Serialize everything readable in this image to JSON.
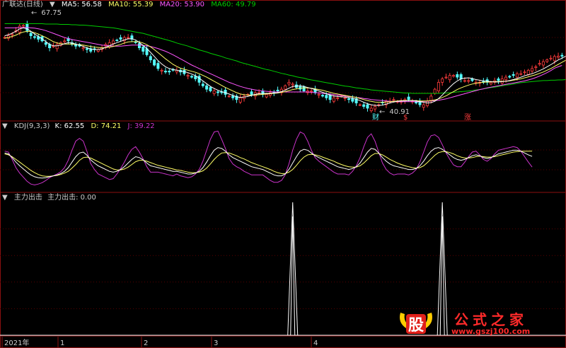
{
  "colors": {
    "background": "#000000",
    "border": "#8b1010",
    "grid": "#5a0000",
    "up_candle": "#ff3c3c",
    "down_candle": "#54ffff",
    "ma5": "#ffffff",
    "ma10": "#ffff66",
    "ma20": "#ff55ff",
    "ma60": "#00cc00",
    "kdj_k": "#ffffff",
    "kdj_d": "#ffff66",
    "kdj_j": "#cc33cc",
    "signal": "#ffffff"
  },
  "price_panel": {
    "title": "广联达(日线)",
    "ma5_label": "MA5: 56.58",
    "ma10_label": "MA10: 55.39",
    "ma20_label": "MA20: 53.90",
    "ma60_label": "MA60: 49.79",
    "high_marker": "67.75",
    "low_marker": "40.91",
    "flag_cai": "财",
    "flag_s": "$",
    "flag_zhang": "涨"
  },
  "kdj_panel": {
    "title": "KDJ(9,3,3)",
    "k_label": "K: 62.55",
    "d_label": "D: 74.21",
    "j_label": "J: 39.22"
  },
  "signal_panel": {
    "title": "主力出击",
    "value_label": "主力出击: 0.00"
  },
  "time_axis": {
    "labels": [
      "2021年",
      "1",
      "2",
      "3",
      "4"
    ]
  },
  "watermark": {
    "logo_char": "股",
    "title": "公式之家",
    "url": "www.gszj100.com"
  },
  "chart_data": [
    {
      "type": "line",
      "name": "price candlestick with moving averages",
      "x_range": [
        0,
        150
      ],
      "ylim": [
        38,
        70
      ],
      "close": [
        62,
        62.5,
        63,
        64,
        65.3,
        65.5,
        64,
        62.5,
        62,
        61.5,
        61,
        60,
        59,
        59.5,
        60,
        60.5,
        61,
        61,
        60,
        59.5,
        59.5,
        59,
        58.5,
        58,
        58.5,
        58.5,
        59,
        60,
        60.5,
        61,
        61.2,
        61.5,
        62,
        62,
        61.5,
        60.5,
        59,
        58,
        57,
        55.5,
        54,
        53,
        52.5,
        52,
        52,
        52.5,
        52.5,
        52,
        51.5,
        51,
        50.5,
        50,
        49,
        48,
        47,
        46.5,
        46.5,
        46,
        46,
        45.5,
        45,
        44.5,
        44,
        44.5,
        45,
        45.5,
        45.5,
        46,
        46,
        45.5,
        45.5,
        46,
        46,
        46.5,
        47,
        48,
        49,
        48.5,
        47.5,
        47,
        46.5,
        46.5,
        46.5,
        46,
        45.5,
        45,
        44.5,
        44,
        44.5,
        44.5,
        45,
        44.5,
        44,
        43.5,
        43,
        42.5,
        42,
        41.5,
        41.5,
        42,
        42.5,
        43,
        43.5,
        43.5,
        44,
        43.5,
        43.5,
        44,
        44,
        43.5,
        43,
        42.5,
        42.5,
        43.5,
        45,
        47,
        49,
        50,
        50.5,
        51,
        51,
        50.5,
        50,
        49.5,
        49.5,
        49.5,
        49,
        49,
        49,
        49,
        49,
        49.5,
        49.5,
        50,
        50.5,
        50.5,
        51,
        51.5,
        51.5,
        52,
        52.5,
        53,
        53.5,
        54.5,
        55,
        55.5,
        56,
        56.5,
        56.6,
        56.58
      ],
      "ma5": [
        62.5,
        62.8,
        63.2,
        63.8,
        64.5,
        64.8,
        64.5,
        63.8,
        63,
        62.3,
        61.6,
        60.8,
        60,
        59.6,
        59.6,
        59.8,
        60.2,
        60.5,
        60.4,
        60.1,
        59.8,
        59.4,
        59,
        58.7,
        58.5,
        58.5,
        58.7,
        59.1,
        59.6,
        60.1,
        60.5,
        60.9,
        61.3,
        61.6,
        61.6,
        61.3,
        60.5,
        59.7,
        58.8,
        57.7,
        56.5,
        55.3,
        54.3,
        53.5,
        53,
        52.7,
        52.5,
        52.3,
        52.1,
        51.8,
        51.4,
        50.9,
        50.2,
        49.4,
        48.6,
        47.8,
        47.2,
        46.7,
        46.3,
        46,
        45.6,
        45.2,
        44.8,
        44.6,
        44.7,
        44.9,
        45.2,
        45.5,
        45.7,
        45.8,
        45.8,
        45.8,
        45.9,
        46,
        46.3,
        46.7,
        47.3,
        47.8,
        47.9,
        48,
        47.8,
        47.5,
        47.2,
        46.9,
        46.5,
        46.1,
        45.7,
        45.3,
        45,
        44.9,
        44.8,
        44.7,
        44.6,
        44.4,
        44.1,
        43.7,
        43.2,
        42.8,
        42.5,
        42.3,
        42.3,
        42.4,
        42.7,
        43,
        43.3,
        43.5,
        43.6,
        43.6,
        43.7,
        43.7,
        43.6,
        43.4,
        43.2,
        43,
        43.1,
        43.5,
        44.3,
        45.3,
        46.5,
        47.6,
        48.6,
        49.4,
        50,
        50.2,
        50.3,
        50.1,
        49.8,
        49.6,
        49.4,
        49.3,
        49.2,
        49.1,
        49.1,
        49.2,
        49.3,
        49.5,
        49.8,
        50.1,
        50.5,
        50.9,
        51.2,
        51.5,
        51.9,
        52.4,
        52.9,
        53.5,
        54.1,
        54.8,
        55.5,
        56,
        56.58
      ],
      "ma10": [
        61.8,
        62,
        62.3,
        62.7,
        63.2,
        63.6,
        63.8,
        63.7,
        63.4,
        63,
        62.5,
        62,
        61.4,
        60.8,
        60.4,
        60.2,
        60.1,
        60.1,
        60.1,
        60,
        59.9,
        59.8,
        59.6,
        59.4,
        59.2,
        59.1,
        59,
        59.1,
        59.2,
        59.4,
        59.7,
        60,
        60.4,
        60.7,
        60.8,
        60.8,
        60.7,
        60.4,
        59.9,
        59.3,
        58.5,
        57.6,
        56.7,
        55.8,
        55,
        54.2,
        53.6,
        53.1,
        52.8,
        52.5,
        52.2,
        51.9,
        51.5,
        51,
        50.5,
        49.9,
        49.3,
        48.7,
        48.1,
        47.5,
        47,
        46.5,
        46,
        45.6,
        45.4,
        45.3,
        45.3,
        45.3,
        45.4,
        45.5,
        45.6,
        45.7,
        45.8,
        45.9,
        46.1,
        46.3,
        46.6,
        46.9,
        47.1,
        47.3,
        47.4,
        47.4,
        47.3,
        47.1,
        46.9,
        46.7,
        46.4,
        46.1,
        45.8,
        45.6,
        45.4,
        45.2,
        45,
        44.8,
        44.6,
        44.3,
        44,
        43.7,
        43.5,
        43.3,
        43.2,
        43.2,
        43.3,
        43.4,
        43.5,
        43.6,
        43.7,
        43.7,
        43.7,
        43.7,
        43.7,
        43.6,
        43.6,
        43.6,
        43.7,
        43.9,
        44.2,
        44.6,
        45.1,
        45.7,
        46.3,
        46.9,
        47.4,
        47.8,
        48.2,
        48.5,
        48.7,
        48.9,
        49,
        49.1,
        49.1,
        49.2,
        49.2,
        49.3,
        49.3,
        49.4,
        49.6,
        49.8,
        50,
        50.3,
        50.6,
        50.9,
        51.2,
        51.6,
        52,
        52.5,
        53,
        53.6,
        54.2,
        54.8,
        55.39
      ],
      "ma20": [
        64.8,
        64.8,
        64.8,
        64.8,
        64.9,
        64.9,
        64.9,
        64.8,
        64.7,
        64.5,
        64.3,
        64,
        63.6,
        63.2,
        62.8,
        62.4,
        62,
        61.7,
        61.4,
        61.2,
        61,
        60.8,
        60.6,
        60.4,
        60.2,
        60,
        59.8,
        59.7,
        59.6,
        59.5,
        59.5,
        59.5,
        59.6,
        59.7,
        59.8,
        59.8,
        59.8,
        59.7,
        59.6,
        59.4,
        59.1,
        58.8,
        58.4,
        58,
        57.5,
        57,
        56.4,
        55.8,
        55.2,
        54.6,
        54,
        53.5,
        53,
        52.5,
        52,
        51.5,
        51,
        50.5,
        50,
        49.5,
        49,
        48.6,
        48.2,
        47.8,
        47.5,
        47.2,
        47,
        46.8,
        46.6,
        46.5,
        46.4,
        46.3,
        46.2,
        46.2,
        46.2,
        46.2,
        46.2,
        46.2,
        46.2,
        46.2,
        46.2,
        46.2,
        46.1,
        46,
        45.9,
        45.8,
        45.7,
        45.6,
        45.4,
        45.3,
        45.2,
        45,
        44.9,
        44.8,
        44.6,
        44.5,
        44.3,
        44.2,
        44,
        43.9,
        43.8,
        43.7,
        43.6,
        43.5,
        43.5,
        43.4,
        43.4,
        43.4,
        43.4,
        43.4,
        43.4,
        43.4,
        43.5,
        43.5,
        43.6,
        43.7,
        43.8,
        44,
        44.2,
        44.5,
        44.8,
        45.1,
        45.4,
        45.7,
        46,
        46.3,
        46.6,
        46.9,
        47.1,
        47.4,
        47.6,
        47.8,
        48,
        48.2,
        48.4,
        48.6,
        48.8,
        49,
        49.2,
        49.4,
        49.7,
        50,
        50.4,
        50.8,
        51.3,
        51.8,
        52.4,
        53.1,
        53.5,
        53.9
      ],
      "ma60": [
        66,
        66,
        66,
        66,
        66,
        66,
        66,
        66,
        66,
        66,
        66,
        65.9,
        65.9,
        65.9,
        65.9,
        65.8,
        65.8,
        65.8,
        65.7,
        65.7,
        65.6,
        65.6,
        65.5,
        65.4,
        65.3,
        65.2,
        65.1,
        65,
        64.9,
        64.8,
        64.6,
        64.4,
        64.2,
        64,
        63.8,
        63.6,
        63.4,
        63.2,
        62.9,
        62.6,
        62.3,
        62,
        61.7,
        61.4,
        61.1,
        60.8,
        60.4,
        60.1,
        59.8,
        59.5,
        59.1,
        58.8,
        58.4,
        58.1,
        57.8,
        57.4,
        57.1,
        56.8,
        56.5,
        56.1,
        55.8,
        55.5,
        55.2,
        54.8,
        54.5,
        54.2,
        53.9,
        53.6,
        53.3,
        53,
        52.7,
        52.5,
        52.2,
        51.9,
        51.6,
        51.4,
        51.1,
        50.9,
        50.6,
        50.4,
        50.2,
        49.9,
        49.7,
        49.5,
        49.3,
        49.1,
        48.9,
        48.7,
        48.5,
        48.3,
        48.1,
        47.9,
        47.8,
        47.6,
        47.4,
        47.3,
        47.1,
        47,
        46.8,
        46.7,
        46.6,
        46.5,
        46.4,
        46.3,
        46.2,
        46.1,
        46,
        45.9,
        45.9,
        45.8,
        45.8,
        45.8,
        45.8,
        45.8,
        45.8,
        45.8,
        45.8,
        45.9,
        45.9,
        46,
        46.1,
        46.2,
        46.3,
        46.4,
        46.5,
        46.6,
        46.8,
        46.9,
        47.1,
        47.3,
        47.5,
        47.6,
        47.8,
        48,
        48.2,
        48.3,
        48.5,
        48.7,
        48.9,
        49,
        49.1,
        49.2,
        49.3,
        49.4,
        49.5,
        49.5,
        49.6,
        49.6,
        49.7,
        49.7,
        49.79
      ]
    },
    {
      "type": "line",
      "name": "KDJ(9,3,3)",
      "ylim": [
        0,
        100
      ],
      "k": [
        70,
        68,
        60,
        50,
        42,
        35,
        28,
        22,
        18,
        16,
        15,
        16,
        18,
        20,
        22,
        25,
        30,
        38,
        50,
        62,
        70,
        72,
        65,
        55,
        48,
        42,
        38,
        34,
        30,
        28,
        30,
        34,
        40,
        48,
        56,
        62,
        60,
        55,
        48,
        42,
        40,
        38,
        36,
        34,
        32,
        30,
        30,
        28,
        26,
        24,
        24,
        26,
        30,
        38,
        50,
        64,
        76,
        82,
        80,
        74,
        66,
        60,
        56,
        52,
        48,
        44,
        40,
        38,
        36,
        34,
        30,
        26,
        22,
        20,
        20,
        24,
        34,
        48,
        62,
        74,
        78,
        76,
        70,
        64,
        60,
        56,
        52,
        48,
        44,
        40,
        38,
        36,
        34,
        36,
        40,
        48,
        60,
        72,
        80,
        78,
        70,
        60,
        52,
        46,
        42,
        40,
        38,
        36,
        34,
        34,
        36,
        42,
        52,
        64,
        74,
        80,
        82,
        78,
        72,
        66,
        60,
        56,
        54,
        56,
        60,
        64,
        66,
        64,
        60,
        58,
        60,
        64,
        68,
        70,
        72,
        74,
        76,
        76,
        74,
        70,
        66,
        62.55
      ],
      "d": [
        68,
        66,
        62,
        56,
        50,
        44,
        38,
        32,
        27,
        23,
        20,
        19,
        19,
        20,
        21,
        23,
        26,
        30,
        37,
        45,
        54,
        60,
        61,
        59,
        55,
        51,
        47,
        43,
        39,
        35,
        33,
        33,
        35,
        39,
        45,
        51,
        54,
        54,
        52,
        49,
        46,
        43,
        41,
        39,
        37,
        35,
        33,
        32,
        30,
        28,
        27,
        27,
        28,
        31,
        37,
        46,
        56,
        64,
        70,
        71,
        70,
        67,
        64,
        60,
        57,
        53,
        49,
        46,
        43,
        40,
        37,
        34,
        30,
        27,
        25,
        25,
        28,
        34,
        43,
        53,
        61,
        66,
        67,
        66,
        64,
        61,
        58,
        55,
        52,
        48,
        45,
        42,
        40,
        39,
        39,
        42,
        48,
        56,
        64,
        69,
        69,
        66,
        61,
        56,
        52,
        48,
        45,
        42,
        40,
        38,
        37,
        38,
        42,
        49,
        57,
        65,
        71,
        73,
        73,
        71,
        68,
        64,
        61,
        59,
        59,
        60,
        62,
        63,
        62,
        61,
        61,
        62,
        64,
        66,
        68,
        70,
        72,
        73,
        74,
        74,
        74,
        74.21
      ],
      "j": [
        74,
        72,
        56,
        38,
        26,
        17,
        8,
        2,
        0,
        2,
        5,
        10,
        16,
        20,
        24,
        29,
        38,
        54,
        76,
        96,
        102,
        96,
        73,
        47,
        34,
        24,
        20,
        16,
        12,
        14,
        24,
        36,
        50,
        66,
        78,
        84,
        72,
        57,
        40,
        28,
        28,
        28,
        26,
        24,
        22,
        20,
        24,
        20,
        18,
        16,
        18,
        24,
        34,
        52,
        76,
        100,
        116,
        118,
        100,
        80,
        58,
        46,
        40,
        36,
        30,
        26,
        22,
        22,
        22,
        22,
        16,
        10,
        6,
        6,
        10,
        22,
        46,
        76,
        100,
        116,
        112,
        96,
        76,
        60,
        52,
        46,
        40,
        34,
        28,
        24,
        24,
        24,
        22,
        30,
        42,
        60,
        84,
        104,
        112,
        96,
        72,
        48,
        34,
        26,
        22,
        24,
        24,
        24,
        22,
        26,
        34,
        50,
        72,
        94,
        108,
        110,
        104,
        88,
        70,
        56,
        44,
        40,
        40,
        50,
        62,
        72,
        74,
        66,
        56,
        52,
        58,
        68,
        76,
        78,
        80,
        82,
        84,
        82,
        74,
        62,
        50,
        39.22
      ]
    },
    {
      "type": "bar",
      "name": "主力出击",
      "ylim": [
        0,
        1
      ],
      "signals": [
        {
          "x": 77,
          "value": 1
        },
        {
          "x": 117,
          "value": 1
        }
      ],
      "current_value": 0.0
    }
  ]
}
